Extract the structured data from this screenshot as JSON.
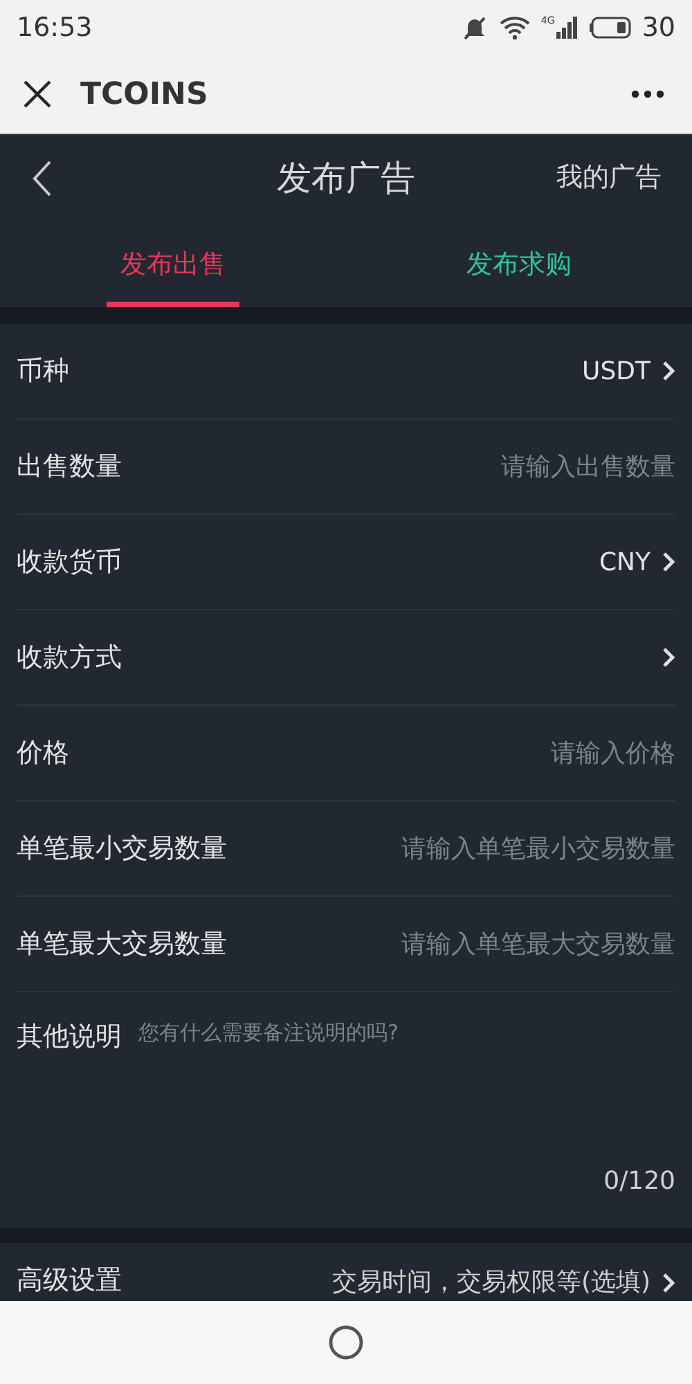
{
  "status_bar": {
    "time": "16:53",
    "network": "4G",
    "battery": "30"
  },
  "app_bar": {
    "title": "TCOINS"
  },
  "header": {
    "title": "发布广告",
    "action": "我的广告"
  },
  "tabs": [
    {
      "label": "发布出售",
      "selected": true,
      "color": "#e8385a"
    },
    {
      "label": "发布求购",
      "selected": false,
      "color": "#2ec4a0"
    }
  ],
  "form_rows": [
    {
      "kind": "select",
      "label": "币种",
      "value": "USDT"
    },
    {
      "kind": "input",
      "label": "出售数量",
      "placeholder": "请输入出售数量"
    },
    {
      "kind": "select",
      "label": "收款货币",
      "value": "CNY"
    },
    {
      "kind": "select",
      "label": "收款方式"
    },
    {
      "kind": "input",
      "label": "价格",
      "placeholder": "请输入价格"
    },
    {
      "kind": "input",
      "label": "单笔最小交易数量",
      "placeholder": "请输入单笔最小交易数量"
    },
    {
      "kind": "input",
      "label": "单笔最大交易数量",
      "placeholder": "请输入单笔最大交易数量"
    }
  ],
  "remarks": {
    "label": "其他说明",
    "placeholder": "您有什么需要备注说明的吗?",
    "counter": "0/120"
  },
  "advanced": {
    "label": "高级设置",
    "value": "交易时间，交易权限等(选填)"
  }
}
